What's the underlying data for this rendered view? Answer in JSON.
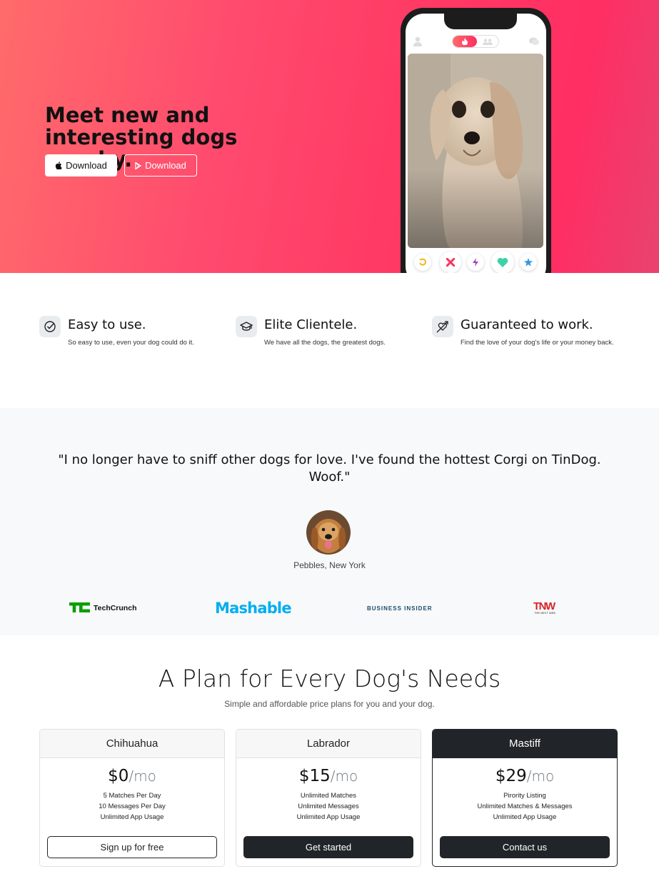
{
  "hero": {
    "title": "Meet new and interesting dogs nearby.",
    "apple_button": "Download",
    "play_button": "Download"
  },
  "features": [
    {
      "icon": "check-circle-icon",
      "title": "Easy to use.",
      "text": "So easy to use, even your dog could do it."
    },
    {
      "icon": "graduation-cap-icon",
      "title": "Elite Clientele.",
      "text": "We have all the dogs, the greatest dogs."
    },
    {
      "icon": "heart-arrow-icon",
      "title": "Guaranteed to work.",
      "text": "Find the love of your dog's life or your money back."
    }
  ],
  "testimonial": {
    "quote": "\"I no longer have to sniff other dogs for love. I've found the hottest Corgi on TinDog. Woof.\"",
    "author": "Pebbles, New York"
  },
  "press": {
    "techcrunch": "TechCrunch",
    "mashable": "Mashable",
    "business_insider": "BUSINESS INSIDER",
    "tnw": "TNW",
    "tnw_sub": "THE NEXT WEB"
  },
  "pricing": {
    "title": "A Plan for Every Dog's Needs",
    "subtitle": "Simple and affordable price plans for you and your dog.",
    "plans": [
      {
        "name": "Chihuahua",
        "price": "$0",
        "period": "/mo",
        "items": [
          "5 Matches Per Day",
          "10 Messages Per Day",
          "Unlimited App Usage"
        ],
        "button": "Sign up for free"
      },
      {
        "name": "Labrador",
        "price": "$15",
        "period": "/mo",
        "items": [
          "Unlimited Matches",
          "Unlimited Messages",
          "Unlimited App Usage"
        ],
        "button": "Get started"
      },
      {
        "name": "Mastiff",
        "price": "$29",
        "period": "/mo",
        "items": [
          "Pirority Listing",
          "Unlimited Matches & Messages",
          "Unlimited App Usage"
        ],
        "button": "Contact us"
      }
    ]
  },
  "colors": {
    "accent": "#ff3a64",
    "dark": "#212529",
    "techcrunch": "#0a9e01",
    "mashable": "#00aeef",
    "tnw": "#d6242a"
  }
}
